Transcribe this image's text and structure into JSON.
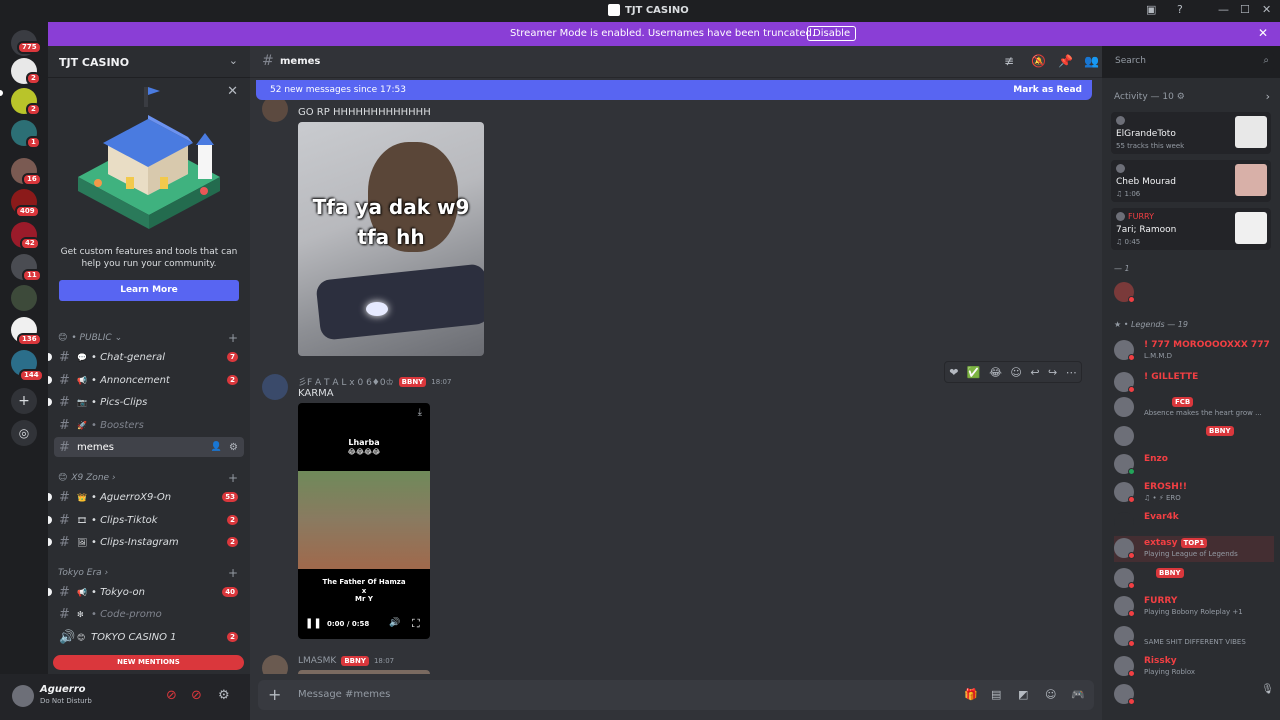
{
  "window": {
    "title": "TJT CASINO",
    "controls": [
      "—",
      "☐",
      "✕"
    ]
  },
  "banner": {
    "text": "Streamer Mode is enabled. Usernames have been truncated.",
    "button": "Disable"
  },
  "rail": {
    "badges": [
      "775",
      "2",
      "2",
      "1",
      "16",
      "409",
      "42",
      "11",
      "136",
      "144"
    ]
  },
  "server": {
    "name": "TJT CASINO"
  },
  "promo": {
    "description": "Get custom features and tools that can help you run your community.",
    "button": "Learn More"
  },
  "categories": [
    {
      "label": "• PUBLIC ⌄",
      "emoji": "😊"
    },
    {
      "label": "X9 Zone ›",
      "emoji": "😊"
    },
    {
      "label": "Tokyo Era ›",
      "emoji": ""
    }
  ],
  "channels": [
    {
      "label": "• Chat-general",
      "emoji": "💬",
      "badge": "7"
    },
    {
      "label": "• Annoncement",
      "emoji": "📢",
      "badge": "2"
    },
    {
      "label": "• Pics-Clips",
      "emoji": "📷",
      "badge": ""
    },
    {
      "label": "• Boosters",
      "emoji": "🚀",
      "badge": ""
    },
    {
      "label": "memes",
      "emoji": "",
      "badge": ""
    },
    {
      "label": "• AguerroX9-On",
      "emoji": "👑",
      "badge": "53"
    },
    {
      "label": "• Clips-Tiktok",
      "emoji": "🎞",
      "badge": "2"
    },
    {
      "label": "• Clips-Instagram",
      "emoji": "🖼",
      "badge": "2"
    },
    {
      "label": "• Tokyo-on",
      "emoji": "📢",
      "badge": "40"
    },
    {
      "label": "• Code-promo",
      "emoji": "❇",
      "badge": ""
    },
    {
      "label": "TOKYO CASINO 1",
      "emoji": "😊",
      "badge": "2"
    }
  ],
  "new_mentions": "NEW MENTIONS",
  "user": {
    "name": "Aguerro",
    "status": "Do Not Disturb"
  },
  "channel_header": {
    "name": "memes"
  },
  "search": {
    "placeholder": "Search"
  },
  "newbar": {
    "left": "52 new messages since 17:53",
    "right": "Mark as Read"
  },
  "messages": [
    {
      "text": "GO RP HHHHHHHHHHHHH",
      "image_caption": "Tfa ya dak w9 tfa hh"
    },
    {
      "user": "彡F A T A L x 0 6♦0♔",
      "tag": "BBNY",
      "time": "18:07",
      "text": "KARMA",
      "video": {
        "top": "Lharba",
        "emojis": "😂😂😂😂",
        "bottom1": "The Father Of Hamza",
        "bottom2": "x",
        "bottom3": "Mr Y",
        "time": "0:00 / 0:58"
      }
    },
    {
      "user": "LMASMK",
      "tag": "BBNY",
      "time": "18:07"
    }
  ],
  "composer": {
    "placeholder": "Message #memes"
  },
  "activity": {
    "header": "Activity — 10 ⚙",
    "cards": [
      {
        "name": "ElGrandeToto",
        "sub": "55 tracks this week"
      },
      {
        "name": "Cheb Mourad",
        "sub": "♫ 1:06"
      },
      {
        "label": "FURRY",
        "name": "7ari; Ramoon",
        "sub": "♫ 0:45"
      }
    ]
  },
  "groups": {
    "g1": "— 1",
    "g2": "★ • Legends — 19"
  },
  "members": [
    {
      "name": "! 777 MOROOOOXXX 777",
      "sub": "L.M.M.D",
      "tag": ""
    },
    {
      "name": "! GILLETTE",
      "sub": "",
      "tag": ""
    },
    {
      "name": "",
      "sub": "Absence makes the heart grow ...",
      "tag": "FCB"
    },
    {
      "name": "",
      "sub": "",
      "tag": "BBNY"
    },
    {
      "name": "Enzo",
      "sub": "",
      "tag": ""
    },
    {
      "name": "EROSH!!",
      "sub": "♫ • ⚡ ERO",
      "tag": ""
    },
    {
      "name": "Evar4k",
      "sub": "",
      "tag": ""
    },
    {
      "name": "extasy",
      "sub": "Playing League of Legends",
      "tag": "TOP1"
    },
    {
      "name": "",
      "sub": "",
      "tag": "BBNY"
    },
    {
      "name": "FURRY",
      "sub": "Playing Bobony Roleplay +1",
      "tag": ""
    },
    {
      "name": "",
      "sub": "SAME SHIT DIFFERENT VIBES",
      "tag": ""
    },
    {
      "name": "Rissky",
      "sub": "Playing Roblox",
      "tag": ""
    },
    {
      "name": "",
      "sub": "",
      "tag": ""
    }
  ],
  "colors": {
    "banner": "#8a3ed6",
    "accent": "#5865f2",
    "mention": "#da373c"
  }
}
